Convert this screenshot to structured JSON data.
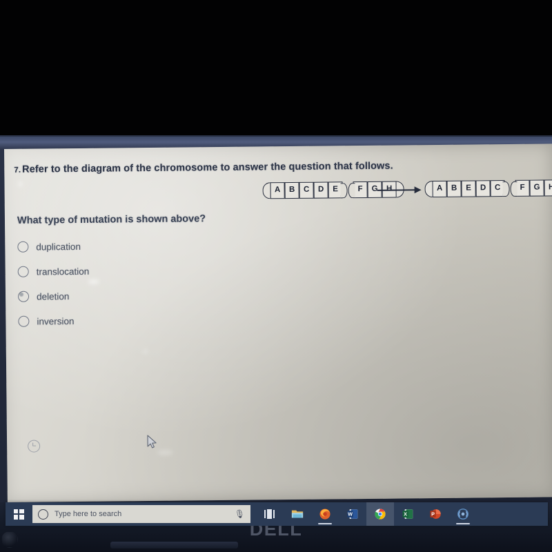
{
  "quiz": {
    "question_number": "7.",
    "question_text": "Refer to the diagram of the chromosome to answer the question that follows.",
    "prompt": "What type of mutation is shown above?",
    "options": [
      {
        "label": "duplication",
        "selected": false
      },
      {
        "label": "translocation",
        "selected": false
      },
      {
        "label": "deletion",
        "selected": false
      },
      {
        "label": "inversion",
        "selected": false
      }
    ]
  },
  "diagram": {
    "type": "chromosome-mutation",
    "arrow": "right-arrow",
    "original": {
      "name": "original-chromosome",
      "genes_left": [
        "A",
        "B",
        "C",
        "D",
        "E"
      ],
      "genes_right": [
        "F",
        "G",
        "H"
      ],
      "centromere": true
    },
    "mutated": {
      "name": "mutated-chromosome",
      "genes_left": [
        "A",
        "B",
        "E",
        "D",
        "C"
      ],
      "genes_right": [
        "F",
        "G",
        "H"
      ],
      "centromere": true
    }
  },
  "taskbar": {
    "start_label": "Start",
    "search_placeholder": "Type here to search",
    "search_value": "",
    "mic_icon": "microphone-icon",
    "task_view_label": "Task View",
    "items": [
      {
        "name": "file-explorer",
        "label": "File Explorer",
        "color": "#e8c15a",
        "running": false,
        "active": false
      },
      {
        "name": "firefox",
        "label": "Firefox",
        "color": "#e2622b",
        "running": true,
        "active": false
      },
      {
        "name": "word",
        "label": "Microsoft Word",
        "color": "#2b579a",
        "running": false,
        "active": false
      },
      {
        "name": "chrome",
        "label": "Google Chrome",
        "color": "#4285f4",
        "running": false,
        "active": true
      },
      {
        "name": "excel",
        "label": "Microsoft Excel",
        "color": "#217346",
        "running": false,
        "active": false
      },
      {
        "name": "powerpoint",
        "label": "Microsoft PowerPoint",
        "color": "#d24726",
        "running": false,
        "active": false
      },
      {
        "name": "blue-circle-app",
        "label": "App",
        "color": "#3f6fae",
        "running": true,
        "active": false
      }
    ]
  },
  "device": {
    "brand": "DELL"
  },
  "colors": {
    "screen_bg": "#cfcdc6",
    "text": "#2c3446",
    "taskbar": "#2b3b55",
    "bezel": "#1b2131"
  }
}
